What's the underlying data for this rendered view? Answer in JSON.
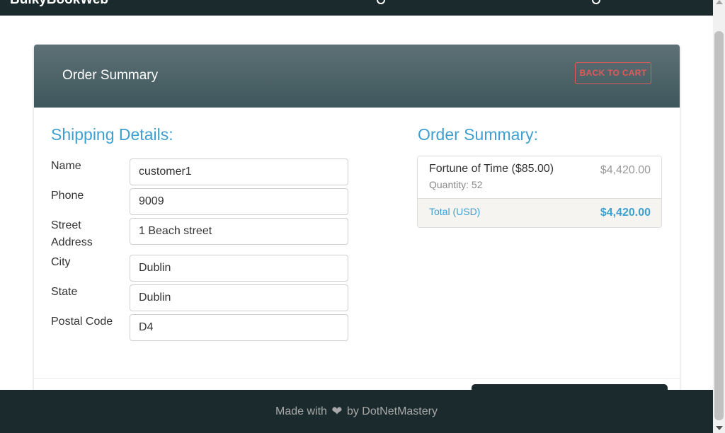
{
  "navbar": {
    "brand": "BulkyBookWeb"
  },
  "header": {
    "title": "Order Summary",
    "back_label": "BACK TO CART"
  },
  "shipping": {
    "heading": "Shipping Details:",
    "fields": [
      {
        "label": "Name",
        "value": "customer1"
      },
      {
        "label": "Phone",
        "value": "9009"
      },
      {
        "label": "Street Address",
        "value": "1 Beach street"
      },
      {
        "label": "City",
        "value": "Dublin"
      },
      {
        "label": "State",
        "value": "Dublin"
      },
      {
        "label": "Postal Code",
        "value": "D4"
      }
    ]
  },
  "summary": {
    "heading": "Order Summary:",
    "item": {
      "title": "Fortune of Time ($85.00)",
      "quantity": "Quantity: 52",
      "price": "$4,420.00"
    },
    "total_label": "Total (USD)",
    "total_value": "$4,420.00"
  },
  "footer": {
    "made_with": "Made with",
    "by": "by DotNetMastery"
  },
  "colors": {
    "navbar": "#1b2a2c",
    "accent": "#3fa0d0",
    "danger": "#e05a5a"
  }
}
